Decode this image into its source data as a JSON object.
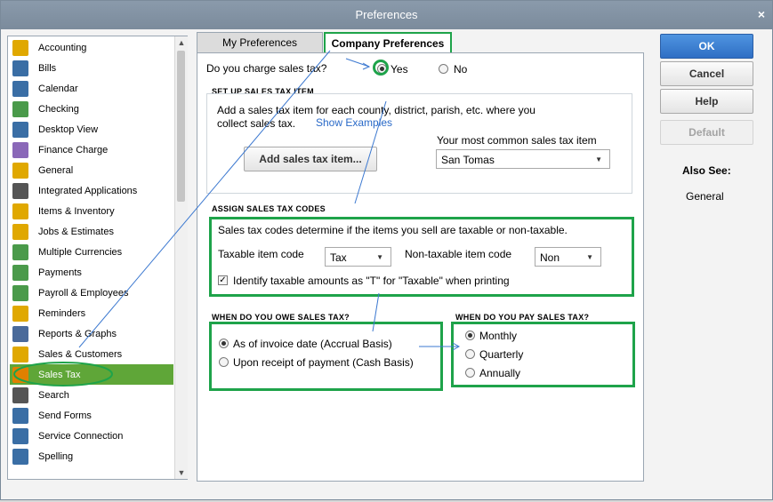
{
  "window": {
    "title": "Preferences",
    "close_glyph": "×"
  },
  "sidebar": {
    "items": [
      {
        "label": "Accounting",
        "icon": "accounting-icon",
        "color": "#e0a800"
      },
      {
        "label": "Bills",
        "icon": "bills-icon",
        "color": "#3a6ea5"
      },
      {
        "label": "Calendar",
        "icon": "calendar-icon",
        "color": "#3a6ea5"
      },
      {
        "label": "Checking",
        "icon": "checking-icon",
        "color": "#4a9a4a"
      },
      {
        "label": "Desktop View",
        "icon": "desktop-view-icon",
        "color": "#3a6ea5"
      },
      {
        "label": "Finance Charge",
        "icon": "finance-charge-icon",
        "color": "#8a68b8"
      },
      {
        "label": "General",
        "icon": "general-icon",
        "color": "#e0a800"
      },
      {
        "label": "Integrated Applications",
        "icon": "integrated-apps-icon",
        "color": "#555"
      },
      {
        "label": "Items & Inventory",
        "icon": "items-inventory-icon",
        "color": "#e0a800"
      },
      {
        "label": "Jobs & Estimates",
        "icon": "jobs-estimates-icon",
        "color": "#e0a800"
      },
      {
        "label": "Multiple Currencies",
        "icon": "multiple-currencies-icon",
        "color": "#4a9a4a"
      },
      {
        "label": "Payments",
        "icon": "payments-icon",
        "color": "#4a9a4a"
      },
      {
        "label": "Payroll & Employees",
        "icon": "payroll-employees-icon",
        "color": "#4a9a4a"
      },
      {
        "label": "Reminders",
        "icon": "reminders-icon",
        "color": "#e0a800"
      },
      {
        "label": "Reports & Graphs",
        "icon": "reports-graphs-icon",
        "color": "#4a6a9a"
      },
      {
        "label": "Sales & Customers",
        "icon": "sales-customers-icon",
        "color": "#e0a800"
      },
      {
        "label": "Sales Tax",
        "icon": "sales-tax-icon",
        "color": "#e08000"
      },
      {
        "label": "Search",
        "icon": "search-icon",
        "color": "#555"
      },
      {
        "label": "Send Forms",
        "icon": "send-forms-icon",
        "color": "#3a6ea5"
      },
      {
        "label": "Service Connection",
        "icon": "service-connection-icon",
        "color": "#3a6ea5"
      },
      {
        "label": "Spelling",
        "icon": "spelling-icon",
        "color": "#3a6ea5"
      }
    ],
    "active_index": 16
  },
  "tabs": {
    "my": "My Preferences",
    "company": "Company Preferences"
  },
  "charge": {
    "question": "Do you charge sales tax?",
    "yes": "Yes",
    "no": "No"
  },
  "setup": {
    "heading": "SET UP SALES TAX ITEM",
    "line1": "Add a sales tax item for each county, district, parish, etc. where you",
    "line2": "collect sales tax.",
    "show_examples": "Show Examples",
    "add_button": "Add sales tax item...",
    "common_label": "Your most common sales tax item",
    "common_value": "San Tomas"
  },
  "codes": {
    "heading": "ASSIGN SALES TAX CODES",
    "desc": "Sales tax codes determine if the items you sell are taxable or non-taxable.",
    "taxable_label": "Taxable item code",
    "taxable_value": "Tax",
    "nontaxable_label": "Non-taxable item code",
    "nontaxable_value": "Non",
    "identify_label": "Identify taxable amounts as \"T\" for \"Taxable\" when printing"
  },
  "owe": {
    "heading": "WHEN DO YOU OWE SALES TAX?",
    "accrual": "As of invoice date (Accrual Basis)",
    "cash": "Upon receipt of payment (Cash Basis)"
  },
  "pay": {
    "heading": "WHEN DO YOU PAY SALES TAX?",
    "monthly": "Monthly",
    "quarterly": "Quarterly",
    "annually": "Annually"
  },
  "buttons": {
    "ok": "OK",
    "cancel": "Cancel",
    "help": "Help",
    "default": "Default"
  },
  "also_see": {
    "heading": "Also See:",
    "link": "General"
  },
  "colors": {
    "highlight": "#1ea34a",
    "active_item": "#5fa638",
    "arrow": "#3b78d0"
  }
}
